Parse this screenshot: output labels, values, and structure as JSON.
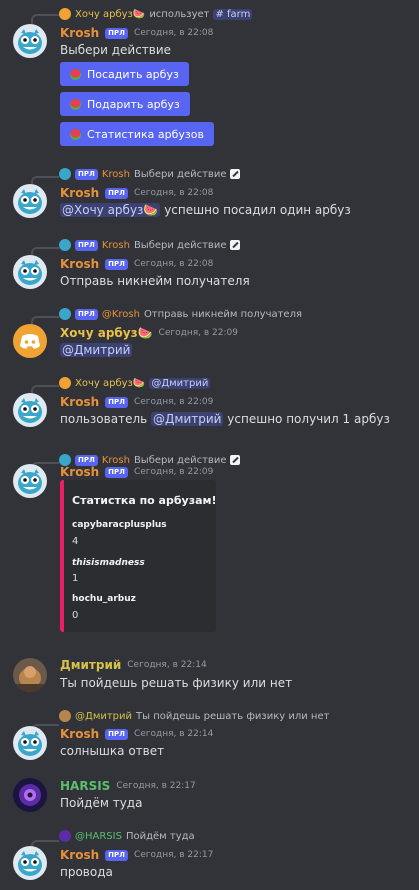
{
  "colors": {
    "krosh": "#e8913a",
    "hochu": "#e8c04a",
    "dmitriy": "#d4c24a",
    "harsis": "#5cbf6b",
    "bot_badge": "#5865f2",
    "mention_bg": "#3c4270",
    "embed_bar": "#e91e63"
  },
  "icons": {
    "krosh_avatar": "blue-creature-avatar",
    "discord_avatar": "discord-logo-avatar",
    "watermelon": "watermelon-emoji",
    "edit": "slash-command-icon"
  },
  "msg1": {
    "reply": {
      "user": "Хочу арбуз🍉",
      "text": "использует",
      "command": "# farm"
    },
    "name": "Krosh",
    "badge": "ПРЛ",
    "time": "Сегодня, в 22:08",
    "text": "Выбери действие",
    "buttons": [
      "Посадить арбуз",
      "Подарить арбуз",
      "Статистика арбузов"
    ]
  },
  "msg2": {
    "reply": {
      "badge": "ПРЛ",
      "user": "Krosh",
      "text": "Выбери действие"
    },
    "name": "Krosh",
    "badge": "ПРЛ",
    "time": "Сегодня, в 22:08",
    "mention": "@Хочу арбуз🍉",
    "text": "успешно посадил один арбуз"
  },
  "msg3": {
    "reply": {
      "badge": "ПРЛ",
      "user": "Krosh",
      "text": "Выбери действие"
    },
    "name": "Krosh",
    "badge": "ПРЛ",
    "time": "Сегодня, в 22:08",
    "text": "Отправь никнейм получателя"
  },
  "msg4": {
    "reply": {
      "badge": "ПРЛ",
      "user": "@Krosh",
      "text": "Отправь никнейм получателя"
    },
    "name": "Хочу арбуз🍉",
    "time": "Сегодня, в 22:09",
    "mention": "@Дмитрий"
  },
  "msg5": {
    "reply": {
      "user": "Хочу арбуз🍉",
      "mention": "@Дмитрий"
    },
    "name": "Krosh",
    "badge": "ПРЛ",
    "time": "Сегодня, в 22:09",
    "text_before": "пользователь",
    "mention": "@Дмитрий",
    "text_after": "успешно получил 1 арбуз"
  },
  "msg6": {
    "reply": {
      "badge": "ПРЛ",
      "user": "Krosh",
      "text": "Выбери действие"
    },
    "name": "Krosh",
    "badge": "ПРЛ",
    "time": "Сегодня, в 22:09",
    "embed": {
      "title": "Статистка по арбузам!",
      "fields": [
        {
          "name": "capybaracplusplus",
          "value": "4"
        },
        {
          "name": "thisismadness",
          "value": "1"
        },
        {
          "name": "hochu_arbuz",
          "value": "0"
        }
      ]
    }
  },
  "msg7": {
    "name": "Дмитрий",
    "time": "Сегодня, в 22:14",
    "text": "Ты пойдешь решать физику или нет"
  },
  "msg8": {
    "reply": {
      "user": "@Дмитрий",
      "text": "Ты пойдешь решать физику или нет"
    },
    "name": "Krosh",
    "badge": "ПРЛ",
    "time": "Сегодня, в 22:14",
    "text": "солнышка ответ"
  },
  "msg9": {
    "name": "HARSIS",
    "time": "Сегодня, в 22:17",
    "text": "Пойдём туда"
  },
  "msg10": {
    "reply": {
      "user": "@HARSIS",
      "text": "Пойдём туда"
    },
    "name": "Krosh",
    "badge": "ПРЛ",
    "time": "Сегодня, в 22:17",
    "text": "провода"
  }
}
